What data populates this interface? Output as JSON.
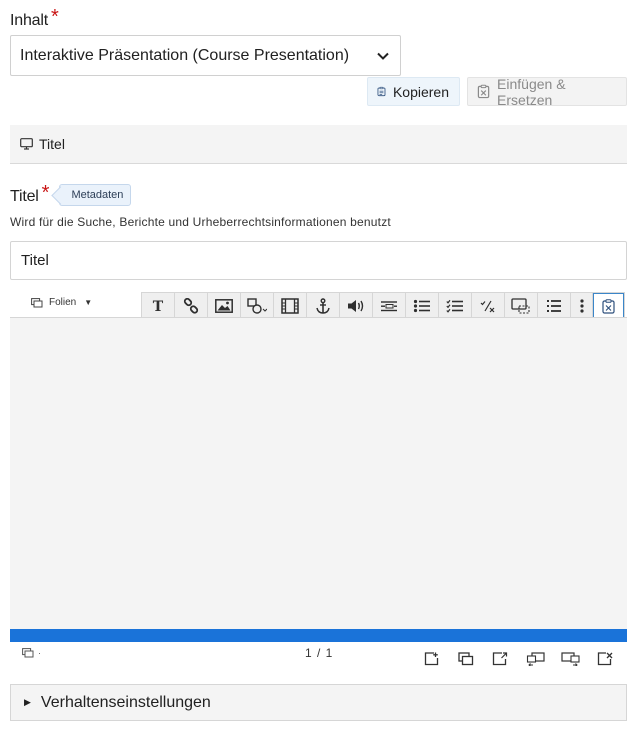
{
  "content": {
    "label": "Inhalt",
    "required_mark": "*",
    "selected_library": "Interaktive Präsentation (Course Presentation)"
  },
  "actions": {
    "copy_label": "Kopieren",
    "paste_replace_label": "Einfügen & Ersetzen"
  },
  "group": {
    "title": "Titel"
  },
  "title_field": {
    "label": "Titel",
    "required_mark": "*",
    "metadata_label": "Metadaten",
    "description": "Wird für die Suche, Berichte und Urheberrechtsinformationen benutzt",
    "value": "Titel"
  },
  "editor": {
    "slides_menu_label": "Folien",
    "toolbar_icons": [
      "text-icon",
      "link-icon",
      "image-icon",
      "shapes-icon",
      "video-icon",
      "anchor-icon",
      "audio-icon",
      "fill-blanks-icon",
      "single-choice-icon",
      "multi-choice-icon",
      "true-false-icon",
      "drag-drop-icon",
      "summary-icon",
      "more-icon",
      "paste-icon"
    ],
    "slide_counter": "1 / 1",
    "footer_icons": [
      "add-slide-icon",
      "clone-slide-icon",
      "background-icon",
      "move-slide-left-icon",
      "move-slide-right-icon",
      "delete-slide-icon"
    ],
    "accent_color": "#1a73d9"
  },
  "behaviour": {
    "label": "Verhaltenseinstellungen"
  }
}
